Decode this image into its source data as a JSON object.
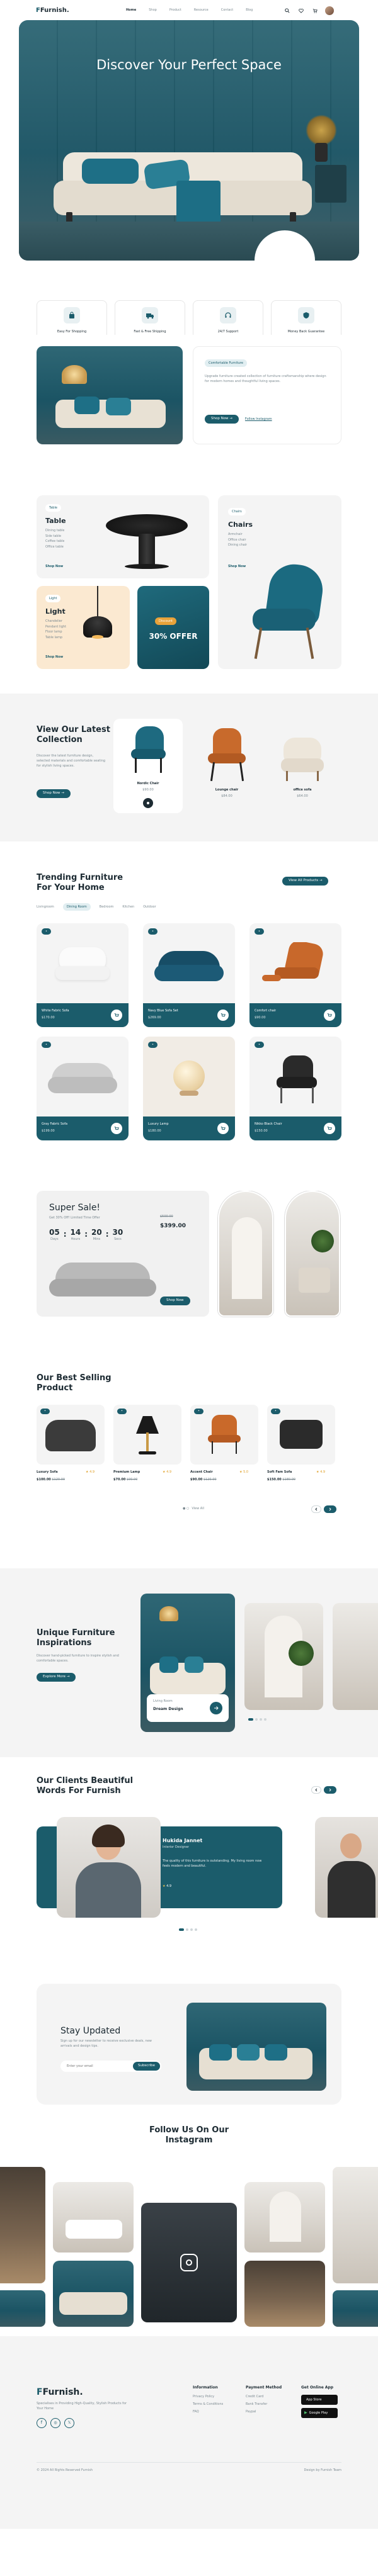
{
  "brand": {
    "name": "Furnish.",
    "accent": "#1b5c6b",
    "accent_dark": "#123f4a",
    "light": "#f4f4f4"
  },
  "nav": {
    "items": [
      "Home",
      "Shop",
      "Product",
      "Resource",
      "Contact",
      "Blog"
    ],
    "icons": [
      "search-icon",
      "heart-icon",
      "cart-icon",
      "user-avatar"
    ]
  },
  "hero": {
    "title": "Discover Your Perfect Space"
  },
  "features": [
    {
      "label": "Easy For Shopping",
      "icon": "bag-icon"
    },
    {
      "label": "Fast & Free Shipping",
      "icon": "truck-icon"
    },
    {
      "label": "24/7 Support",
      "icon": "headset-icon"
    },
    {
      "label": "Money Back Guarantee",
      "icon": "shield-icon"
    }
  ],
  "about": {
    "badge": "Comfortable Furniture",
    "text": "Upgrade furniture created collection of furniture craftsmanship where design for modern homes and thoughtful living spaces.",
    "btn_primary": "Shop Now",
    "btn_secondary": "Follow Instagram"
  },
  "categories": {
    "table": {
      "tag": "Table",
      "title": "Table",
      "lines": [
        "Dining table",
        "Side table",
        "Coffee table",
        "Office table"
      ],
      "link": "Shop Now"
    },
    "chairs": {
      "tag": "Chairs",
      "title": "Chairs",
      "lines": [
        "Armchair",
        "Office chair",
        "Dining chair"
      ],
      "link": "Shop Now"
    },
    "light": {
      "tag": "Light",
      "title": "Light",
      "lines": [
        "Chandelier",
        "Pendant light",
        "Floor lamp",
        "Table lamp"
      ],
      "link": "Shop Now"
    },
    "offer": {
      "tag": "Discount",
      "title": "30% OFFER"
    }
  },
  "chair_collection": {
    "title": "View Our Latest Chair Collection",
    "text": "Discover the latest furniture design, selected materials and comfortable seating for stylish living spaces.",
    "btn": "Shop Now",
    "items": [
      {
        "name": "Nordic Chair",
        "price": "$90.00"
      },
      {
        "name": "Lounge chair",
        "price": "$84.00"
      },
      {
        "name": "office sofa",
        "price": "$64.00"
      }
    ]
  },
  "trending": {
    "title": "Trending Furniture For Your Home",
    "btn": "View All Products",
    "tabs": [
      "Livingroom",
      "Dining Room",
      "Bedroom",
      "Kitchen",
      "Outdoor"
    ],
    "products": [
      {
        "name": "White Fabric Sofa",
        "price": "$170.00"
      },
      {
        "name": "Navy Blue Sofa Set",
        "price": "$269.00"
      },
      {
        "name": "Comfort chair",
        "price": "$90.00"
      },
      {
        "name": "Gray Fabric Sofa",
        "price": "$199.00"
      },
      {
        "name": "Luxury Lamp",
        "price": "$180.00"
      },
      {
        "name": "Nikko Black Chair",
        "price": "$150.00"
      }
    ]
  },
  "sale": {
    "title": "Super Sale!",
    "subtitle": "Get 30% Off! Limited Time Offer",
    "countdown": [
      {
        "v": "05",
        "u": "Days"
      },
      {
        "v": "14",
        "u": "Hours"
      },
      {
        "v": "20",
        "u": "Mins"
      },
      {
        "v": "30",
        "u": "Secs"
      }
    ],
    "old_price": "$500.00",
    "price": "$399.00",
    "btn": "Shop Now"
  },
  "best": {
    "title": "Our Best Selling Product",
    "items": [
      {
        "name": "Luxury Sofa",
        "rating": "4.9",
        "price": "$100.00",
        "old": "$120.00"
      },
      {
        "name": "Premium Lamp",
        "rating": "4.9",
        "price": "$70.00",
        "old": "$90.00"
      },
      {
        "name": "Accent Chair",
        "rating": "5.0",
        "price": "$90.00",
        "old": "$120.00"
      },
      {
        "name": "Soft Fam Sofa",
        "rating": "4.9",
        "price": "$150.00",
        "old": "$180.00"
      }
    ],
    "view_all": "View All"
  },
  "inspiration": {
    "title": "Unique Furniture Inspirations",
    "text": "Discover hand-picked furniture to inspire stylish and comfortable spaces.",
    "btn": "Explore More",
    "caption_small": "Living Room",
    "caption": "Dream Design"
  },
  "testimonial": {
    "title": "Our Clients Beautiful Words For Furnish",
    "name": "Hukida Jannet",
    "role": "Interior Designer",
    "quote": "The quality of this furniture is outstanding. My living room now feels modern and beautiful.",
    "rating": "4.9"
  },
  "newsletter": {
    "title": "Stay Updated",
    "text": "Sign up for our newsletter to receive exclusive deals, new arrivals and design tips.",
    "placeholder": "Enter your email",
    "btn": "Subscribe"
  },
  "instagram": {
    "title": "Follow Us On Our Instagram"
  },
  "footer": {
    "desc": "Specialises in Providing High-Quality, Stylish Products for Your Home",
    "info_title": "Information",
    "info": [
      "Privacy Policy",
      "Terms & Conditions",
      "FAQ"
    ],
    "pay_title": "Payment Method",
    "pay": [
      "Credit Card",
      "Bank Transfer",
      "Paypal"
    ],
    "app_title": "Get Online App",
    "apps": [
      "App Store",
      "Google Play"
    ],
    "copyright": "© 2024 All Rights Reserved Furnish",
    "design": "Design by Furnish Team"
  }
}
